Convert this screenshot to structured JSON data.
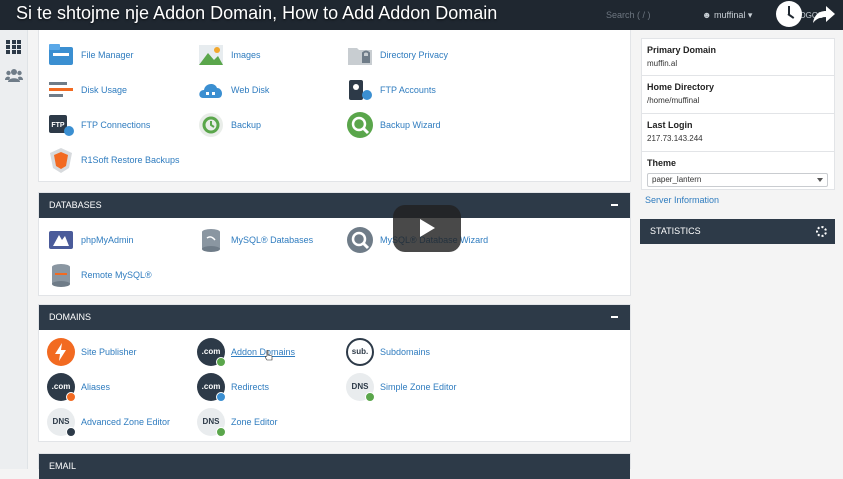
{
  "video": {
    "title": "Si te shtojme nje Addon Domain, How to Add Addon Domain"
  },
  "header": {
    "search_placeholder": "Search ( / )",
    "username": "muffinal",
    "logout_label": "LOGOUT"
  },
  "files": {
    "items": [
      {
        "label": "File Manager",
        "icon": "file-manager-icon"
      },
      {
        "label": "Images",
        "icon": "images-icon"
      },
      {
        "label": "Directory Privacy",
        "icon": "directory-privacy-icon"
      },
      {
        "label": "Disk Usage",
        "icon": "disk-usage-icon"
      },
      {
        "label": "Web Disk",
        "icon": "web-disk-icon"
      },
      {
        "label": "FTP Accounts",
        "icon": "ftp-accounts-icon"
      },
      {
        "label": "FTP Connections",
        "icon": "ftp-connections-icon"
      },
      {
        "label": "Backup",
        "icon": "backup-icon"
      },
      {
        "label": "Backup Wizard",
        "icon": "backup-wizard-icon"
      },
      {
        "label": "R1Soft Restore Backups",
        "icon": "r1soft-icon"
      }
    ]
  },
  "databases": {
    "heading": "DATABASES",
    "items": [
      {
        "label": "phpMyAdmin",
        "icon": "phpmyadmin-icon"
      },
      {
        "label": "MySQL® Databases",
        "icon": "mysql-databases-icon"
      },
      {
        "label": "MySQL® Database Wizard",
        "icon": "mysql-wizard-icon"
      },
      {
        "label": "Remote MySQL®",
        "icon": "remote-mysql-icon"
      }
    ]
  },
  "domains": {
    "heading": "DOMAINS",
    "items": [
      {
        "label": "Site Publisher",
        "icon": "site-publisher-icon"
      },
      {
        "label": "Addon Domains",
        "icon": "addon-domains-icon",
        "badge": ".com"
      },
      {
        "label": "Subdomains",
        "icon": "subdomains-icon",
        "badge": "sub."
      },
      {
        "label": "Aliases",
        "icon": "aliases-icon",
        "badge": ".com"
      },
      {
        "label": "Redirects",
        "icon": "redirects-icon",
        "badge": ".com"
      },
      {
        "label": "Simple Zone Editor",
        "icon": "simple-zone-editor-icon",
        "badge": "DNS"
      },
      {
        "label": "Advanced Zone Editor",
        "icon": "advanced-zone-editor-icon",
        "badge": "DNS"
      },
      {
        "label": "Zone Editor",
        "icon": "zone-editor-icon",
        "badge": "DNS"
      }
    ]
  },
  "email": {
    "heading": "EMAIL"
  },
  "general_info": {
    "primary_domain_label": "Primary Domain",
    "primary_domain_value": "muffin.al",
    "home_directory_label": "Home Directory",
    "home_directory_value": "/home/muffinal",
    "last_login_label": "Last Login",
    "last_login_value": "217.73.143.244",
    "theme_label": "Theme",
    "theme_value": "paper_lantern",
    "server_info_link": "Server Information"
  },
  "statistics": {
    "heading": "STATISTICS"
  },
  "colors": {
    "header_bg": "#2d3a48",
    "link": "#2f7cbf",
    "accent_orange": "#f26a21"
  }
}
